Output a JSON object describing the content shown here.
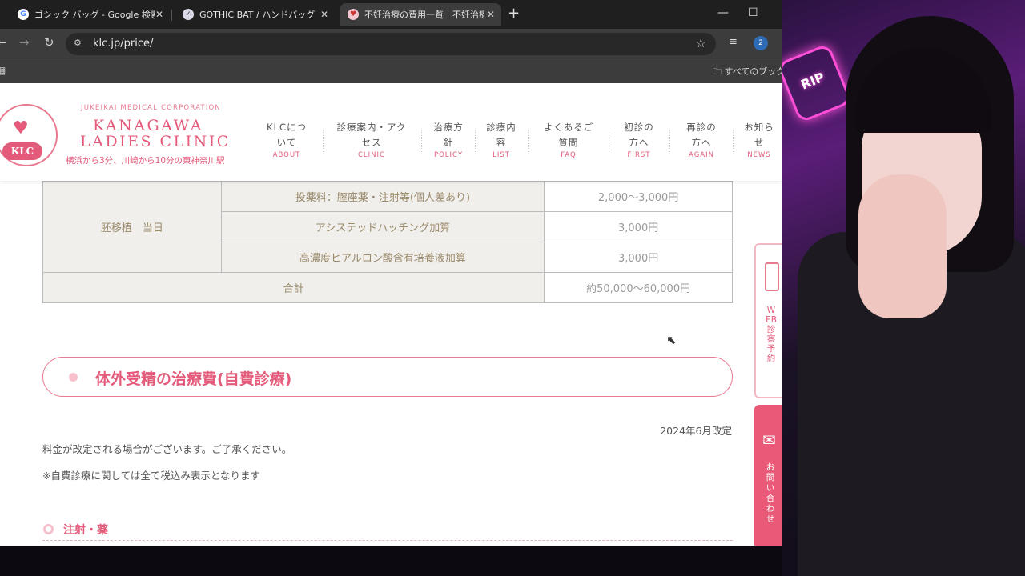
{
  "browser": {
    "tabs": [
      {
        "title": "ゴシック バッグ - Google 検索",
        "favicon": "google-icon"
      },
      {
        "title": "GOTHIC BAT / ハンドバッグ【Bann",
        "favicon": "check-icon"
      },
      {
        "title": "不妊治療の費用一覧｜不妊治療",
        "favicon": "clinic-icon"
      }
    ],
    "new_tab": "+",
    "url": "klc.jp/price/",
    "bookmark_folder": "すべてのブックマ",
    "profile_initial": "2"
  },
  "site": {
    "corp": "JUKEIKAI MEDICAL CORPORATION",
    "name_line1": "KANAGAWA",
    "name_line2": "LADIES CLINIC",
    "logo_text": "KLC",
    "access": "横浜から3分、川崎から10分の東神奈川駅",
    "nav": [
      {
        "jp1": "KLCにつ",
        "jp2": "いて",
        "en": "ABOUT"
      },
      {
        "jp1": "診療案内・アク",
        "jp2": "セス",
        "en": "CLINIC"
      },
      {
        "jp1": "治療方",
        "jp2": "針",
        "en": "POLICY"
      },
      {
        "jp1": "診療内",
        "jp2": "容",
        "en": "LIST"
      },
      {
        "jp1": "よくあるご",
        "jp2": "質問",
        "en": "FAQ"
      },
      {
        "jp1": "初診の",
        "jp2": "方へ",
        "en": "FIRST"
      },
      {
        "jp1": "再診の",
        "jp2": "方へ",
        "en": "AGAIN"
      },
      {
        "jp1": "お知ら",
        "jp2": "せ",
        "en": "NEWS"
      }
    ]
  },
  "price_table": {
    "group_label": "胚移植　当日",
    "rows": [
      {
        "item": "投薬料：膣座薬・注射等(個人差あり)",
        "price": "2,000〜3,000円"
      },
      {
        "item": "アシステッドハッチング加算",
        "price": "3,000円"
      },
      {
        "item": "高濃度ヒアルロン酸含有培養液加算",
        "price": "3,000円"
      }
    ],
    "total_label": "合計",
    "total_price": "約50,000〜60,000円"
  },
  "section": {
    "title": "体外受精の治療費(自費診療)",
    "revised": "2024年6月改定",
    "note1": "料金が改定される場合がございます。ご了承ください。",
    "note2": "※自費診療に関しては全て税込み表示となります",
    "subheading": "注射・薬"
  },
  "side_buttons": {
    "web_label": "WEB診察予約",
    "contact_label": "お問い合わせ"
  },
  "overlay": {
    "sign_text": "RIP"
  }
}
